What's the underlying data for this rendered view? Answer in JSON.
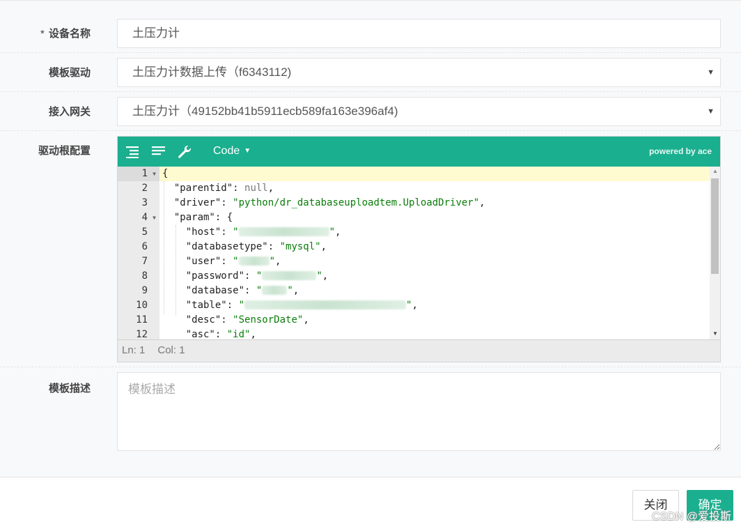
{
  "form": {
    "device_name": {
      "required_mark": "*",
      "label": "设备名称",
      "value": "土压力计"
    },
    "template_driver": {
      "label": "模板驱动",
      "value": "土压力计数据上传（f6343112)"
    },
    "gateway": {
      "label": "接入网关",
      "value": "土压力计（49152bb41b5911ecb589fa163e396af4)"
    },
    "driver_config": {
      "label": "驱动根配置"
    },
    "template_desc": {
      "label": "模板描述",
      "placeholder": "模板描述"
    }
  },
  "editor": {
    "toolbar": {
      "icons": [
        "format-icon",
        "wrap-icon",
        "settings-icon"
      ],
      "mode_label": "Code",
      "powered_label": "powered by ace"
    },
    "line_numbers": [
      "1",
      "2",
      "3",
      "4",
      "5",
      "6",
      "7",
      "8",
      "9",
      "10",
      "11",
      "12"
    ],
    "code": {
      "l1": "{",
      "l2_key": "\"parentid\"",
      "l2_val": "null",
      "l3_key": "\"driver\"",
      "l3_val": "\"python/dr_databaseuploadtem.UploadDriver\"",
      "l4_key": "\"param\"",
      "l4_val": "{",
      "l5_key": "\"host\"",
      "l6_key": "\"databasetype\"",
      "l6_val": "\"mysql\"",
      "l7_key": "\"user\"",
      "l8_key": "\"password\"",
      "l9_key": "\"database\"",
      "l10_key": "\"table\"",
      "l11_key": "\"desc\"",
      "l11_val": "\"SensorDate\"",
      "l12_key": "\"asc\"",
      "l12_val": "\"id\""
    },
    "status": {
      "ln": "Ln: 1",
      "col": "Col: 1"
    }
  },
  "footer": {
    "close_label": "关闭",
    "ok_label": "确定",
    "watermark": "CSDN @爱投斯"
  },
  "colors": {
    "accent": "#1aaf8f",
    "string": "#0a7d0a",
    "active_line": "#fffbd1"
  }
}
